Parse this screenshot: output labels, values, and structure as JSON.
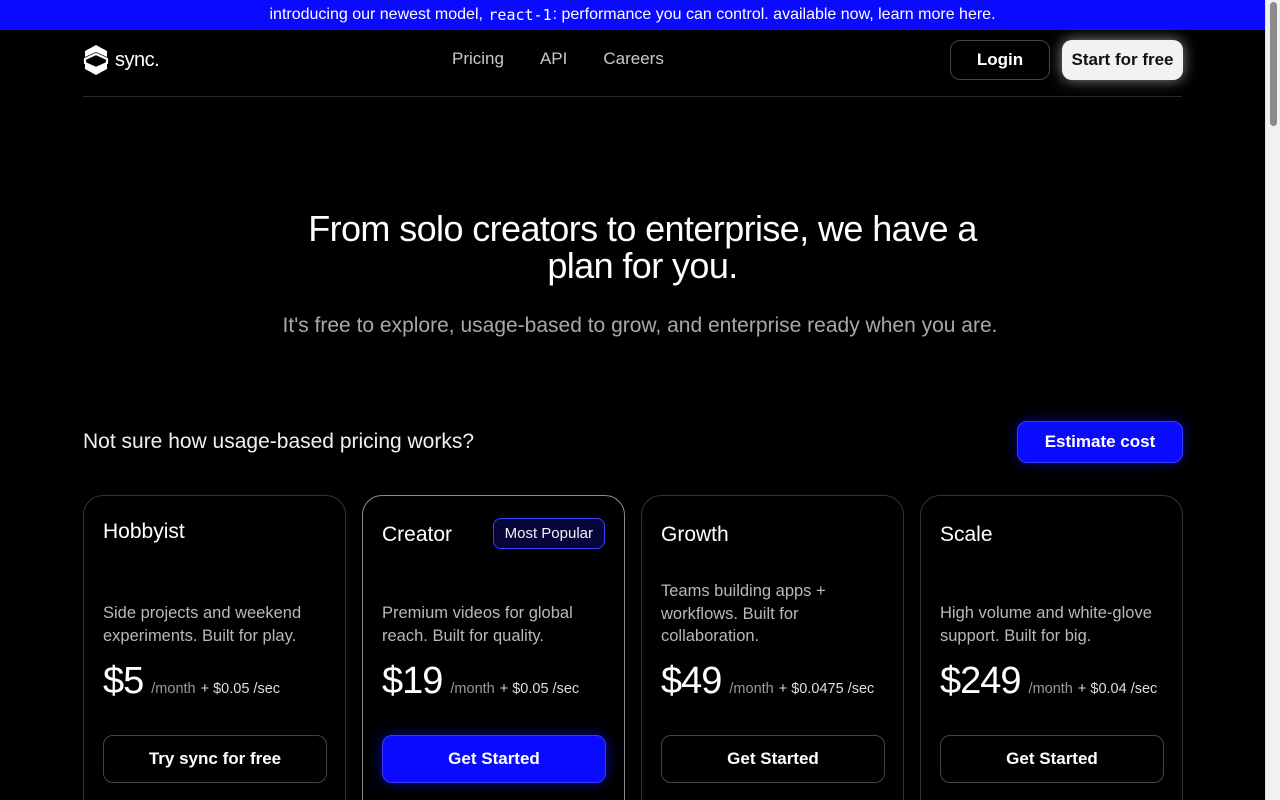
{
  "banner": {
    "before": "introducing our newest model,",
    "code": "react-1",
    "after": ": performance you can control. available now, learn more here."
  },
  "nav": {
    "logo_text": "sync.",
    "links": [
      "Pricing",
      "API",
      "Careers"
    ],
    "login_label": "Login",
    "start_label": "Start for free"
  },
  "hero": {
    "title": "From solo creators to enterprise, we have a plan for you.",
    "subtitle": "It's free to explore, usage-based to grow, and enterprise ready when you are."
  },
  "usage": {
    "question": "Not sure how usage-based pricing works?",
    "estimate_label": "Estimate cost"
  },
  "plans": [
    {
      "name": "Hobbyist",
      "badge": "",
      "description": "Side projects and weekend experiments. Built for play.",
      "price": "$5",
      "period": "/month",
      "extra": "+ $0.05 /sec",
      "cta": "Try sync for free"
    },
    {
      "name": "Creator",
      "badge": "Most Popular",
      "description": "Premium videos for global reach. Built for quality.",
      "price": "$19",
      "period": "/month",
      "extra": "+ $0.05 /sec",
      "cta": "Get Started"
    },
    {
      "name": "Growth",
      "badge": "",
      "description": "Teams building apps + workflows. Built for collaboration.",
      "price": "$49",
      "period": "/month",
      "extra": "+ $0.0475 /sec",
      "cta": "Get Started"
    },
    {
      "name": "Scale",
      "badge": "",
      "description": "High volume and white-glove support. Built for big.",
      "price": "$249",
      "period": "/month",
      "extra": "+ $0.04 /sec",
      "cta": "Get Started"
    }
  ],
  "colors": {
    "accent": "#0a0aff",
    "background": "#000000",
    "text": "#ffffff",
    "muted": "#a8a8a8"
  }
}
